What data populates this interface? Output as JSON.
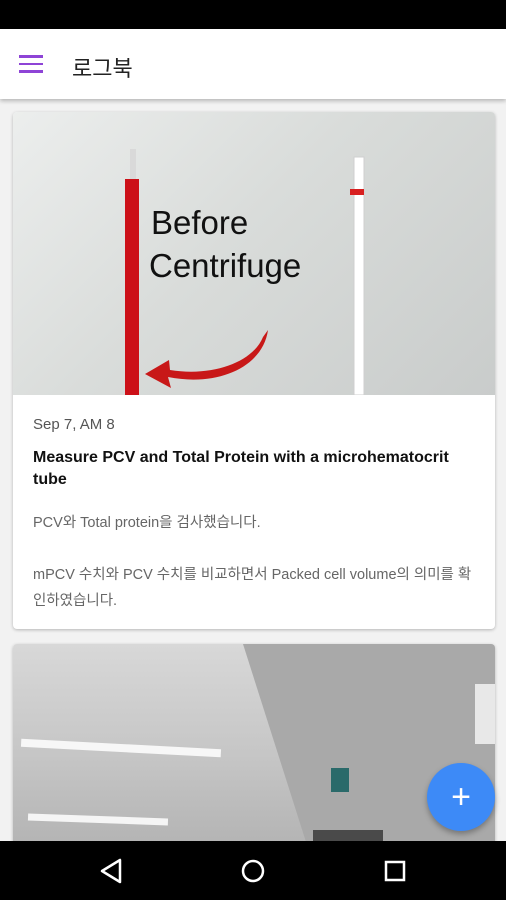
{
  "app_bar": {
    "title": "로그북",
    "menu_icon": "hamburger-menu-icon"
  },
  "cards": [
    {
      "image_text": [
        "Before",
        "Centrifuge"
      ],
      "date": "Sep 7, AM 8",
      "title": "Measure PCV and Total Protein with a microhematocrit tube",
      "body": [
        "PCV와 Total protein을 검사했습니다.",
        "mPCV 수치와 PCV 수치를 비교하면서 Packed cell volume의 의미를 확인하였습니다."
      ]
    },
    {
      "image": "office-ceiling-photo"
    }
  ],
  "fab": {
    "icon": "plus-icon",
    "label": "+"
  },
  "nav": {
    "back": "back-icon",
    "home": "home-icon",
    "recents": "recents-icon"
  },
  "colors": {
    "menu_icon": "#8e44d6",
    "fab": "#3d8af7",
    "tube_blood": "#cc1018",
    "arrow": "#c81818"
  }
}
